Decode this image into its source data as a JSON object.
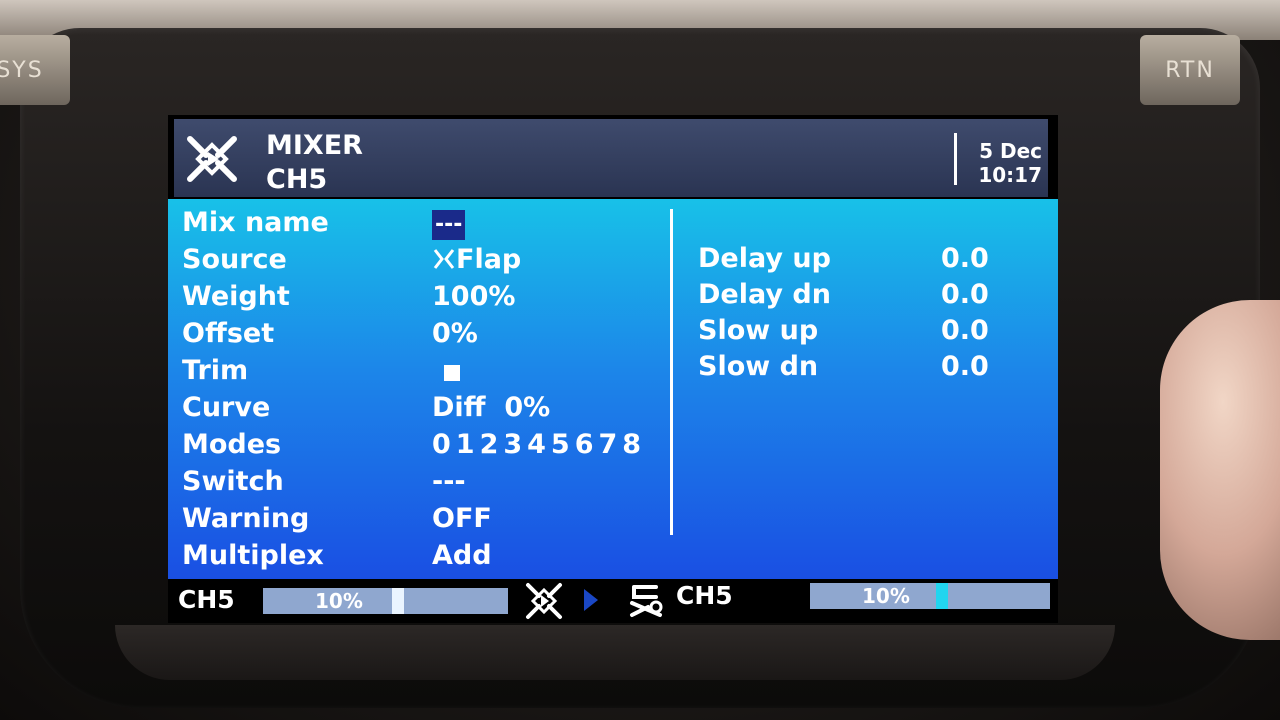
{
  "device": {
    "hw_left_label": "SYS",
    "hw_right_label": "RTN"
  },
  "header": {
    "title": "MIXER",
    "subtitle": "CH5",
    "date": "5 Dec",
    "time": "10:17"
  },
  "fields": {
    "mix_name": {
      "label": "Mix name",
      "value": "---"
    },
    "source": {
      "label": "Source",
      "value": "Flap"
    },
    "weight": {
      "label": "Weight",
      "value": "100%"
    },
    "offset": {
      "label": "Offset",
      "value": "0%"
    },
    "trim": {
      "label": "Trim",
      "checked": true
    },
    "curve": {
      "label": "Curve",
      "value": "Diff  0%"
    },
    "modes": {
      "label": "Modes",
      "value": "012345678"
    },
    "switch": {
      "label": "Switch",
      "value": "---"
    },
    "warning": {
      "label": "Warning",
      "value": "OFF"
    },
    "multiplex": {
      "label": "Multiplex",
      "value": "Add"
    }
  },
  "right_fields": {
    "delay_up": {
      "label": "Delay up",
      "value": "0.0"
    },
    "delay_dn": {
      "label": "Delay dn",
      "value": "0.0"
    },
    "slow_up": {
      "label": "Slow up",
      "value": "0.0"
    },
    "slow_dn": {
      "label": "Slow dn",
      "value": "0.0"
    }
  },
  "footer": {
    "left_channel": "CH5",
    "left_percent": "10%",
    "left_level": 0.1,
    "right_channel": "CH5",
    "right_percent": "10%",
    "right_level": 0.1
  }
}
